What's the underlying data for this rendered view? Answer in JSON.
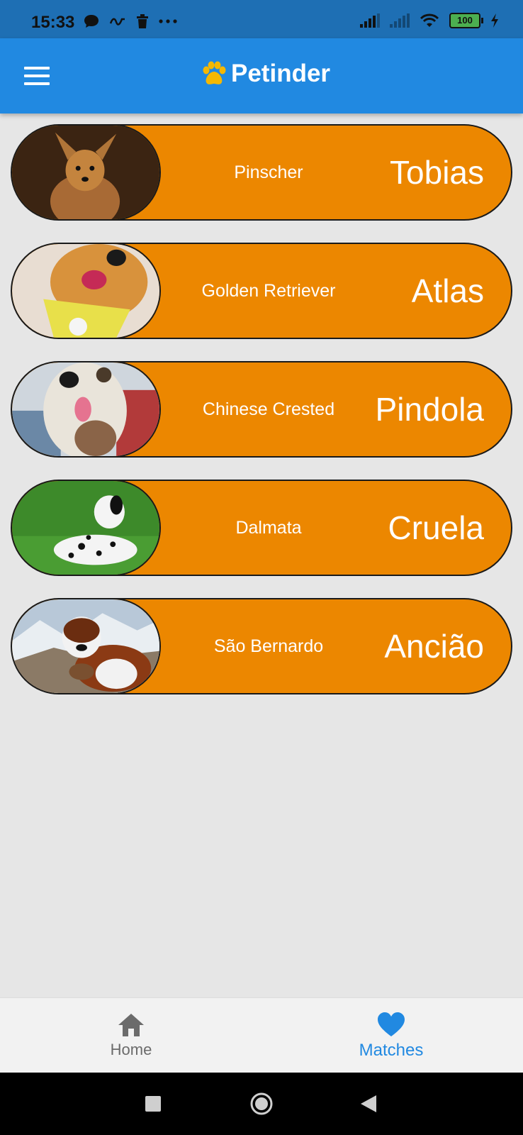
{
  "status_bar": {
    "time": "15:33",
    "battery": "100"
  },
  "app_bar": {
    "title": "Petinder",
    "accent_color": "#2189e1",
    "logo_color": "#f5b800"
  },
  "matches": [
    {
      "breed": "Pinscher",
      "name": "Tobias"
    },
    {
      "breed": "Golden Retriever",
      "name": "Atlas"
    },
    {
      "breed": "Chinese Crested",
      "name": "Pindola"
    },
    {
      "breed": "Dalmata",
      "name": "Cruela"
    },
    {
      "breed": "São Bernardo",
      "name": "Ancião"
    }
  ],
  "card_color": "#ec8700",
  "bottom_nav": {
    "home_label": "Home",
    "matches_label": "Matches",
    "active": "Matches"
  }
}
